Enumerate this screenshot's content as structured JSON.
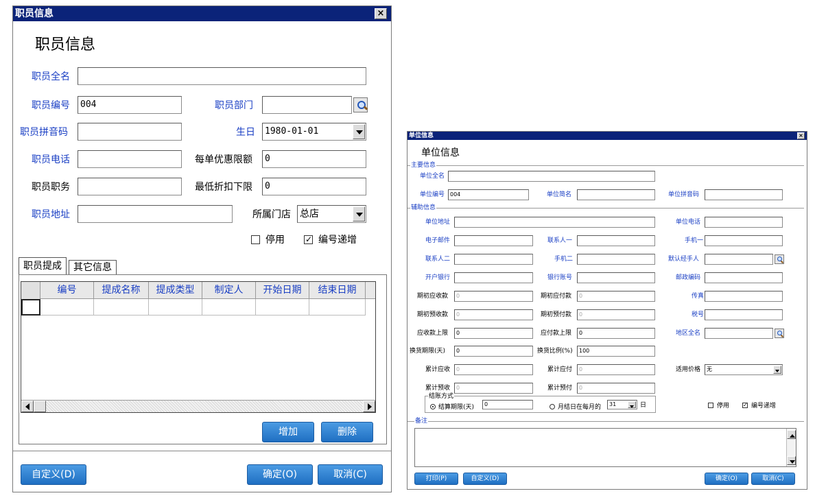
{
  "colors": {
    "titlebar": "#0b2379",
    "label_blue": "#1a3fc4",
    "button": "#2f80d0"
  },
  "left": {
    "title": "职员信息",
    "heading": "职员信息",
    "close": "×",
    "labels": {
      "full_name": "职员全名",
      "code": "职员编号",
      "dept": "职员部门",
      "pinyin": "职员拼音码",
      "birthday": "生日",
      "phone": "职员电话",
      "discount_limit": "每单优惠限额",
      "position": "职员职务",
      "min_discount": "最低折扣下限",
      "address": "职员地址",
      "store": "所属门店"
    },
    "values": {
      "full_name": "",
      "code": "004",
      "dept": "",
      "pinyin": "",
      "birthday": "1980-01-01",
      "phone": "",
      "discount_limit": "0",
      "position": "",
      "min_discount": "0",
      "address": "",
      "store": "总店"
    },
    "checks": {
      "disabled": "停用",
      "disabled_on": false,
      "auto_inc": "编号递增",
      "auto_inc_on": true
    },
    "tabs": [
      "职员提成",
      "其它信息"
    ],
    "grid_headers": [
      "编号",
      "提成名称",
      "提成类型",
      "制定人",
      "开始日期",
      "结束日期"
    ],
    "buttons": {
      "add": "增加",
      "delete": "删除",
      "custom": "自定义(D)",
      "ok": "确定(O)",
      "cancel": "取消(C)"
    }
  },
  "right": {
    "title": "单位信息",
    "heading": "单位信息",
    "close": "×",
    "groups": {
      "main": "主要信息",
      "aux": "辅助信息",
      "settle": "结账方式",
      "memo": "备注"
    },
    "labels": {
      "full_name": "单位全名",
      "code": "单位编号",
      "short_name": "单位简名",
      "pinyin": "单位拼音码",
      "address": "单位地址",
      "phone": "单位电话",
      "email": "电子邮件",
      "contact1": "联系人一",
      "mobile1": "手机一",
      "contact2": "联系人二",
      "mobile2": "手机二",
      "default_handler": "默认经手人",
      "bank": "开户银行",
      "bank_account": "银行账号",
      "postcode": "邮政编码",
      "init_receivable": "期初应收款",
      "init_payable": "期初应付款",
      "fax": "传真",
      "init_advance_recv": "期初预收款",
      "init_advance_pay": "期初预付款",
      "tax_no": "税号",
      "recv_limit": "应收款上限",
      "pay_limit": "应付款上限",
      "region": "地区全名",
      "exchange_days": "换货期限(天)",
      "exchange_ratio": "换货比例(%)",
      "total_recv": "累计应收",
      "total_pay": "累计应付",
      "price": "适用价格",
      "total_adv_recv": "累计预收",
      "total_adv_pay": "累计预付",
      "settle_days": "结算期限(天)",
      "settle_monthly": "月结日在每月的",
      "day_unit": "日"
    },
    "values": {
      "full_name": "",
      "code": "004",
      "init_receivable": "0",
      "init_payable": "0",
      "init_advance_recv": "0",
      "init_advance_pay": "0",
      "recv_limit": "0",
      "pay_limit": "0",
      "exchange_days": "0",
      "exchange_ratio": "100",
      "total_recv": "0",
      "total_pay": "0",
      "price": "无",
      "total_adv_recv": "0",
      "total_adv_pay": "0",
      "settle_days": "0",
      "settle_monthly_day": "31"
    },
    "checks": {
      "disabled": "停用",
      "disabled_on": false,
      "auto_inc": "编号递增",
      "auto_inc_on": true
    },
    "buttons": {
      "print": "打印(P)",
      "custom": "自定义(D)",
      "ok": "确定(O)",
      "cancel": "取消(C)"
    }
  }
}
